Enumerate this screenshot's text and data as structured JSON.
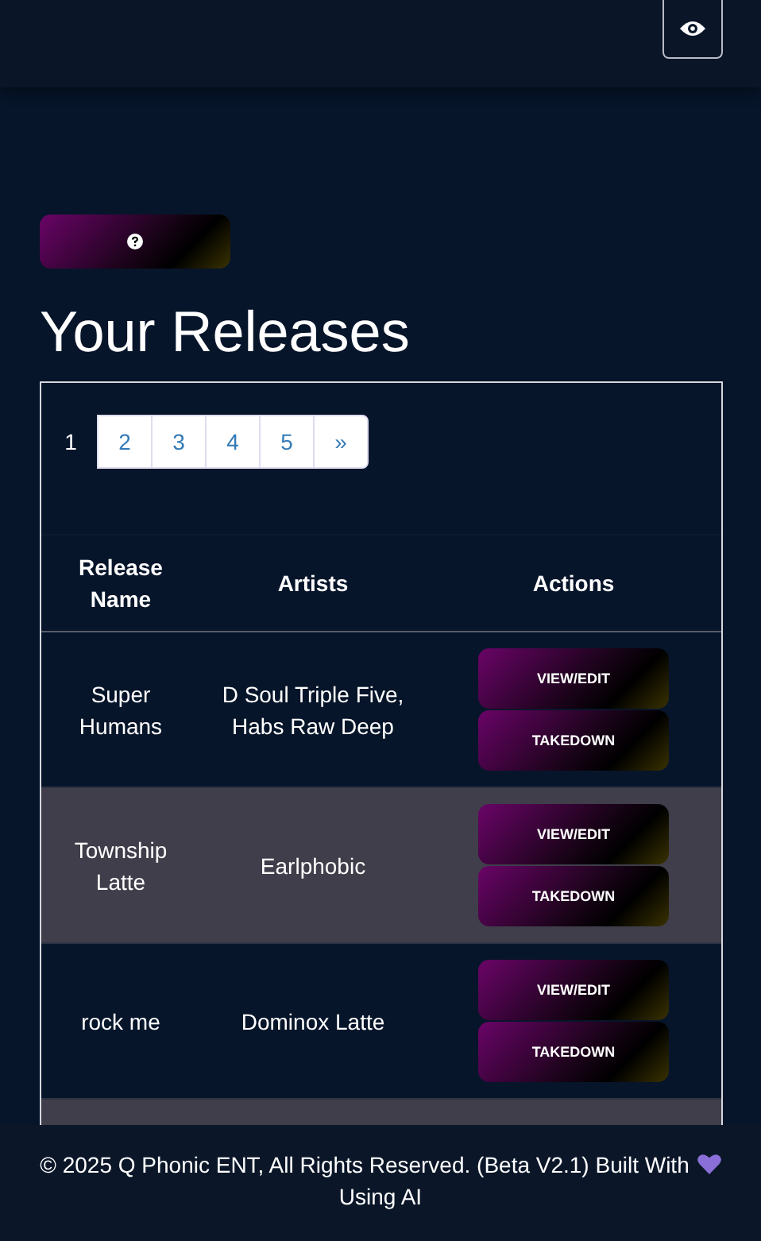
{
  "title": "Your Releases",
  "pagination": {
    "pages": [
      {
        "label": "1",
        "selected": true
      },
      {
        "label": "2",
        "selected": false
      },
      {
        "label": "3",
        "selected": false
      },
      {
        "label": "4",
        "selected": false
      },
      {
        "label": "5",
        "selected": false
      }
    ],
    "next": "»"
  },
  "table": {
    "columns": [
      "Release Name",
      "Artists",
      "Actions"
    ],
    "rows": [
      {
        "release_name": "Super Humans",
        "artists": "D Soul Triple Five, Habs Raw Deep",
        "actions": [
          "VIEW/EDIT",
          "TAKEDOWN"
        ]
      },
      {
        "release_name": "Township Latte",
        "artists": "Earlphobic",
        "actions": [
          "VIEW/EDIT",
          "TAKEDOWN"
        ]
      },
      {
        "release_name": "rock me",
        "artists": "Dominox Latte",
        "actions": [
          "VIEW/EDIT",
          "TAKEDOWN"
        ]
      }
    ]
  },
  "footer": {
    "text": "© 2025 Q Phonic ENT, All Rights Reserved. (Beta V2.1) Built With",
    "tail": "Using AI"
  }
}
